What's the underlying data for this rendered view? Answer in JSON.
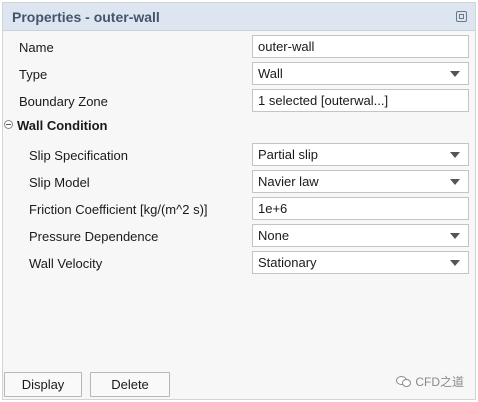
{
  "panel": {
    "title": "Properties - outer-wall",
    "title_icon": "restore-window-icon"
  },
  "properties": {
    "name": {
      "label": "Name",
      "value": "outer-wall"
    },
    "type": {
      "label": "Type",
      "value": "Wall"
    },
    "boundary_zone": {
      "label": "Boundary Zone",
      "value": "1 selected [outerwal...]"
    }
  },
  "wall_condition": {
    "header": "Wall Condition",
    "slip_specification": {
      "label": "Slip Specification",
      "value": "Partial slip"
    },
    "slip_model": {
      "label": "Slip Model",
      "value": "Navier law"
    },
    "friction_coefficient": {
      "label": "Friction Coefficient [kg/(m^2 s)]",
      "value": "1e+6"
    },
    "pressure_dependence": {
      "label": "Pressure Dependence",
      "value": "None"
    },
    "wall_velocity": {
      "label": "Wall Velocity",
      "value": "Stationary"
    }
  },
  "buttons": {
    "display": "Display",
    "delete": "Delete"
  },
  "watermark": {
    "text": "CFD之道",
    "icon": "wechat-icon"
  }
}
